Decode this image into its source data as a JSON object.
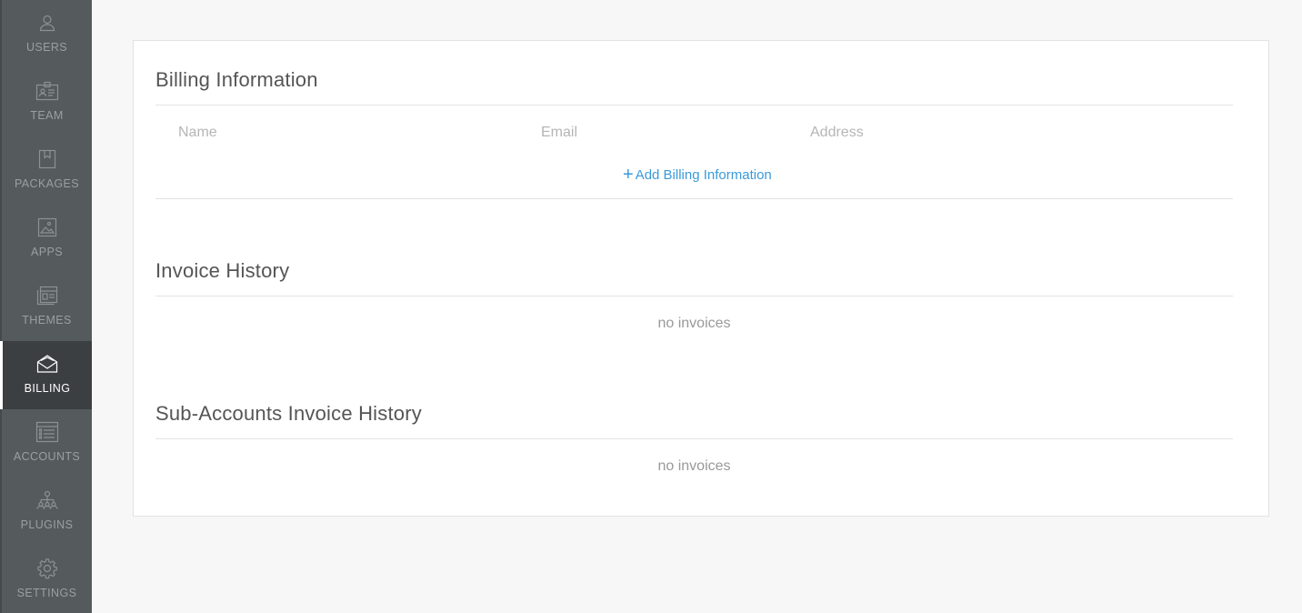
{
  "sidebar": {
    "items": [
      {
        "label": "USERS",
        "icon": "user-icon",
        "active": false
      },
      {
        "label": "TEAM",
        "icon": "team-icon",
        "active": false
      },
      {
        "label": "PACKAGES",
        "icon": "package-icon",
        "active": false
      },
      {
        "label": "APPS",
        "icon": "image-icon",
        "active": false
      },
      {
        "label": "THEMES",
        "icon": "themes-icon",
        "active": false
      },
      {
        "label": "BILLING",
        "icon": "billing-icon",
        "active": true
      },
      {
        "label": "ACCOUNTS",
        "icon": "accounts-icon",
        "active": false
      },
      {
        "label": "PLUGINS",
        "icon": "plugins-icon",
        "active": false
      },
      {
        "label": "SETTINGS",
        "icon": "gear-icon",
        "active": false
      }
    ]
  },
  "billing": {
    "title": "Billing Information",
    "columns": [
      "Name",
      "Email",
      "Address"
    ],
    "add_plus": "+",
    "add_label": "Add Billing Information"
  },
  "invoices": {
    "title": "Invoice History",
    "empty_text": "no invoices"
  },
  "sub_invoices": {
    "title": "Sub-Accounts Invoice History",
    "empty_text": "no invoices"
  },
  "colors": {
    "sidebar_bg": "#555a5c",
    "sidebar_active_bg": "#3c3f41",
    "accent": "#3b9ad9"
  }
}
